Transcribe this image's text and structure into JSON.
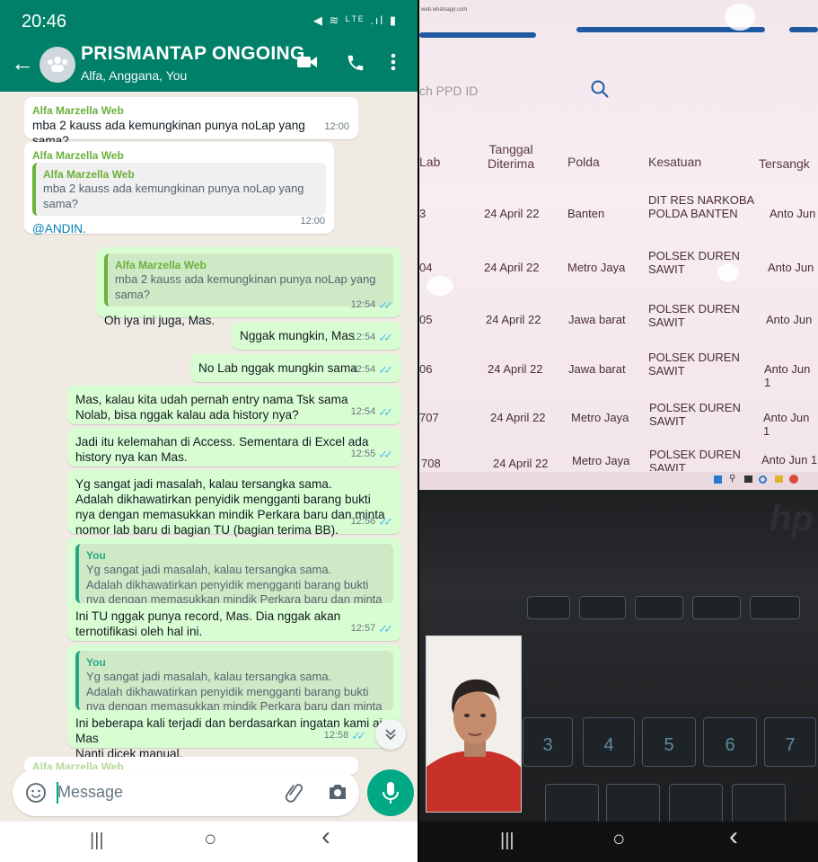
{
  "status": {
    "time": "20:46",
    "icons": "◀ ≋ ᴸᵀᴱ .ıl ▮"
  },
  "header": {
    "title": "PRISMANTAP ONGOING",
    "subtitle": "Alfa, Anggana, You"
  },
  "messages": [
    {
      "sender": "Alfa Marzella Web",
      "text": "mba 2 kauss ada kemungkinan punya noLap yang sama?",
      "time": "12:00"
    },
    {
      "sender": "Alfa Marzella Web",
      "quote_name": "Alfa Marzella Web",
      "quote_text": "mba 2 kauss ada kemungkinan punya noLap yang sama?",
      "text": "@ANDIN.",
      "time": "12:00"
    },
    {
      "quote_name": "Alfa Marzella Web",
      "quote_text": "mba 2 kauss ada kemungkinan punya noLap yang sama?",
      "text": "Oh iya ini juga, Mas.",
      "time": "12:54"
    },
    {
      "text": "Nggak mungkin, Mas",
      "time": "12:54"
    },
    {
      "text": "No Lab nggak mungkin sama",
      "time": "12:54"
    },
    {
      "text": "Mas, kalau kita udah pernah entry nama Tsk sama Nolab, bisa nggak kalau ada history nya?",
      "time": "12:54"
    },
    {
      "text": "Jadi itu kelemahan di Access. Sementara di Excel ada history nya kan Mas.",
      "time": "12:55"
    },
    {
      "text": "Yg sangat jadi masalah, kalau tersangka sama.\nAdalah dikhawatirkan penyidik mengganti barang bukti nya dengan memasukkan mindik Perkara baru dan minta nomor lab baru di bagian TU (bagian terima BB).",
      "time": "12:56"
    },
    {
      "quote_name": "You",
      "quote_text": "Yg sangat jadi masalah, kalau tersangka sama.\nAdalah dikhawatirkan penyidik mengganti barang bukti nya dengan memasukkan mindik Perkara baru dan minta nomor l...",
      "text": "Ini TU nggak punya record, Mas. Dia nggak akan ternotifikasi oleh hal ini.",
      "time": "12:57"
    },
    {
      "quote_name": "You",
      "quote_text": "Yg sangat jadi masalah, kalau tersangka sama.\nAdalah dikhawatirkan penyidik mengganti barang bukti nya dengan memasukkan mindik Perkara baru dan minta nomor l...",
      "text": "Ini beberapa kali terjadi dan berdasarkan ingatan kami aja, Mas\nNanti dicek manual.",
      "time": "12:58"
    }
  ],
  "partial_sender": "Alfa Marzella Web",
  "input": {
    "placeholder": "Message"
  },
  "nav": {
    "recent": "|||",
    "home": "○",
    "back": "‹"
  },
  "photo": {
    "url": "web.whatsapp.com",
    "search_placeholder": "ch PPD ID",
    "columns": [
      "Lab",
      "Tanggal\nDiterima",
      "Polda",
      "Kesatuan",
      "Tersangk"
    ],
    "rows": [
      [
        "3",
        "24 April 22",
        "Banten",
        "DIT RES NARKOBA\nPOLDA BANTEN",
        "Anto Jun"
      ],
      [
        "04",
        "24 April 22",
        "Metro Jaya",
        "POLSEK DUREN\nSAWIT",
        "Anto Jun"
      ],
      [
        "05",
        "24 April 22",
        "Jawa barat",
        "POLSEK DUREN\nSAWIT",
        "Anto Jun"
      ],
      [
        "06",
        "24 April 22",
        "Jawa barat",
        "POLSEK DUREN\nSAWIT",
        "Anto Jun 1"
      ],
      [
        "707",
        "24 April 22",
        "Metro Jaya",
        "POLSEK DUREN\nSAWIT",
        "Anto Jun 1"
      ],
      [
        "708",
        "24 April 22",
        "Metro Jaya",
        "POLSEK DUREN\nSAWIT",
        "Anto Jun 1"
      ]
    ],
    "keys": [
      "3",
      "4",
      "5",
      "6",
      "7"
    ],
    "key_symbols": [
      "#",
      "$",
      "%",
      "^",
      "&"
    ],
    "brand": "hp"
  },
  "colors": {
    "header": "#008069",
    "accent": "#00a884",
    "outgoing": "#d9fdd3",
    "tick": "#53bdeb"
  }
}
